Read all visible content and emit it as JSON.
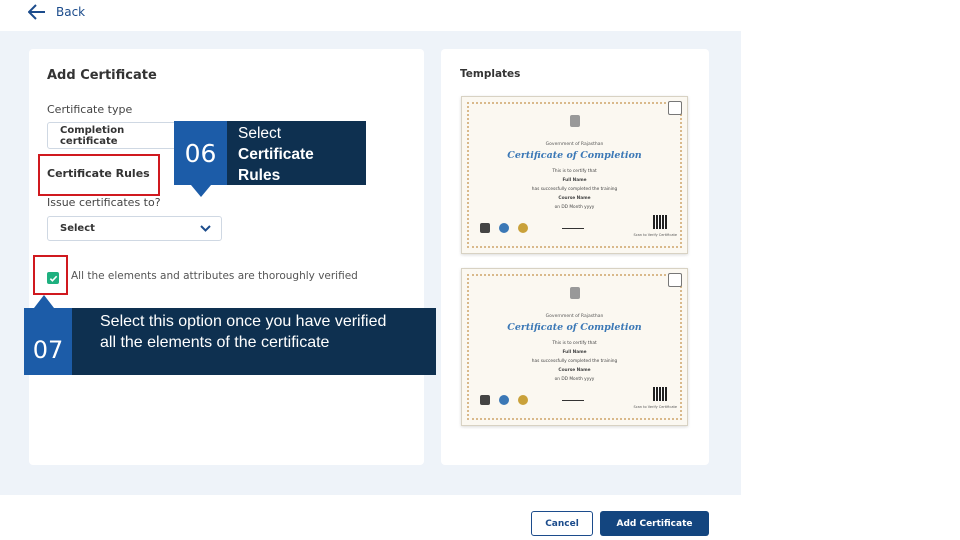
{
  "nav": {
    "back_label": "Back"
  },
  "form": {
    "title": "Add Certificate",
    "certificate_type_label": "Certificate type",
    "certificate_type_value": "Completion certificate",
    "rules_heading": "Certificate Rules",
    "issue_to_label": "Issue certificates to?",
    "issue_to_value": "Select",
    "verify_text": "All the elements and attributes are thoroughly verified"
  },
  "templates": {
    "title": "Templates",
    "items": [
      {
        "gov": "Government of Rajasthan",
        "title": "Certificate of Completion",
        "certify": "This is to certify that",
        "name": "Full Name",
        "completed": "has successfully completed the training",
        "course": "Course Name",
        "date": "on DD Month yyyy",
        "scan": "Scan to Verify Certificate"
      },
      {
        "gov": "Government of Rajasthan",
        "title": "Certificate of Completion",
        "certify": "This is to certify that",
        "name": "Full Name",
        "completed": "has successfully completed the training",
        "course": "Course Name",
        "date": "on DD Month yyyy",
        "scan": "Scan to Verify Certificate"
      }
    ]
  },
  "callouts": {
    "step6": {
      "number": "06",
      "line1": "Select",
      "line2": "Certificate",
      "line3": "Rules"
    },
    "step7": {
      "number": "07",
      "line1": "Select this option once you have verified",
      "line2": "all the elements of the certificate"
    }
  },
  "footer": {
    "cancel_label": "Cancel",
    "add_label": "Add Certificate"
  },
  "colors": {
    "accent": "#13457f",
    "callout": "#0e3050",
    "callout_number": "#1c5ca8",
    "highlight": "#d0191f",
    "check": "#1eb07f"
  }
}
